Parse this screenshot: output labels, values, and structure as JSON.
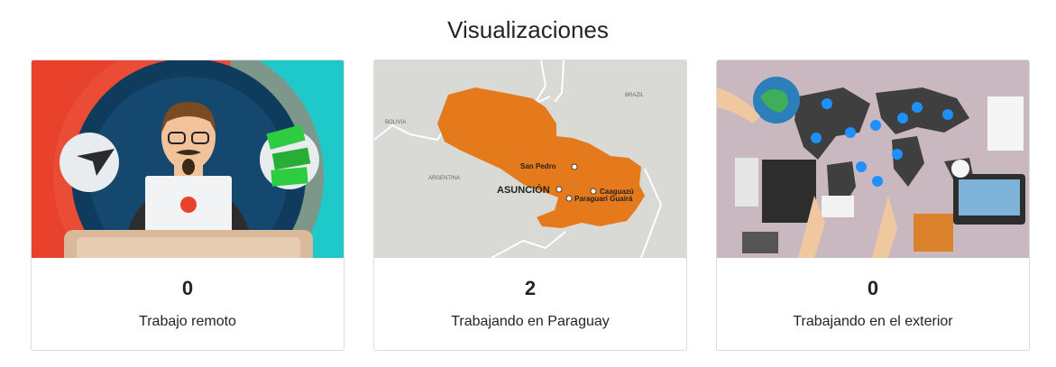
{
  "section": {
    "title": "Visualizaciones"
  },
  "cards": [
    {
      "count": "0",
      "label": "Trabajo remoto"
    },
    {
      "count": "2",
      "label": "Trabajando en Paraguay"
    },
    {
      "count": "0",
      "label": "Trabajando en el exterior"
    }
  ],
  "map": {
    "labels": {
      "bolivia": "BOLIVIA",
      "brazil": "BRAZIL",
      "argentina": "ARGENTINA",
      "san_pedro": "San Pedro",
      "asuncion": "ASUNCIÓN",
      "caaguazu": "Caaguazú",
      "paraguari_guaira": "Paraguarí Guairá"
    }
  },
  "colors": {
    "remote_bg_left": "#e8412c",
    "remote_bg_right": "#1fc9c9",
    "remote_circle": "#0f3b5c",
    "paraguay_fill": "#e57a1c",
    "map_bg": "#d9d9d6",
    "world_bg": "#c9b8bf"
  },
  "icons": {
    "remote": "remote-worker-illustration",
    "paraguay": "paraguay-map-illustration",
    "world": "world-business-illustration"
  }
}
